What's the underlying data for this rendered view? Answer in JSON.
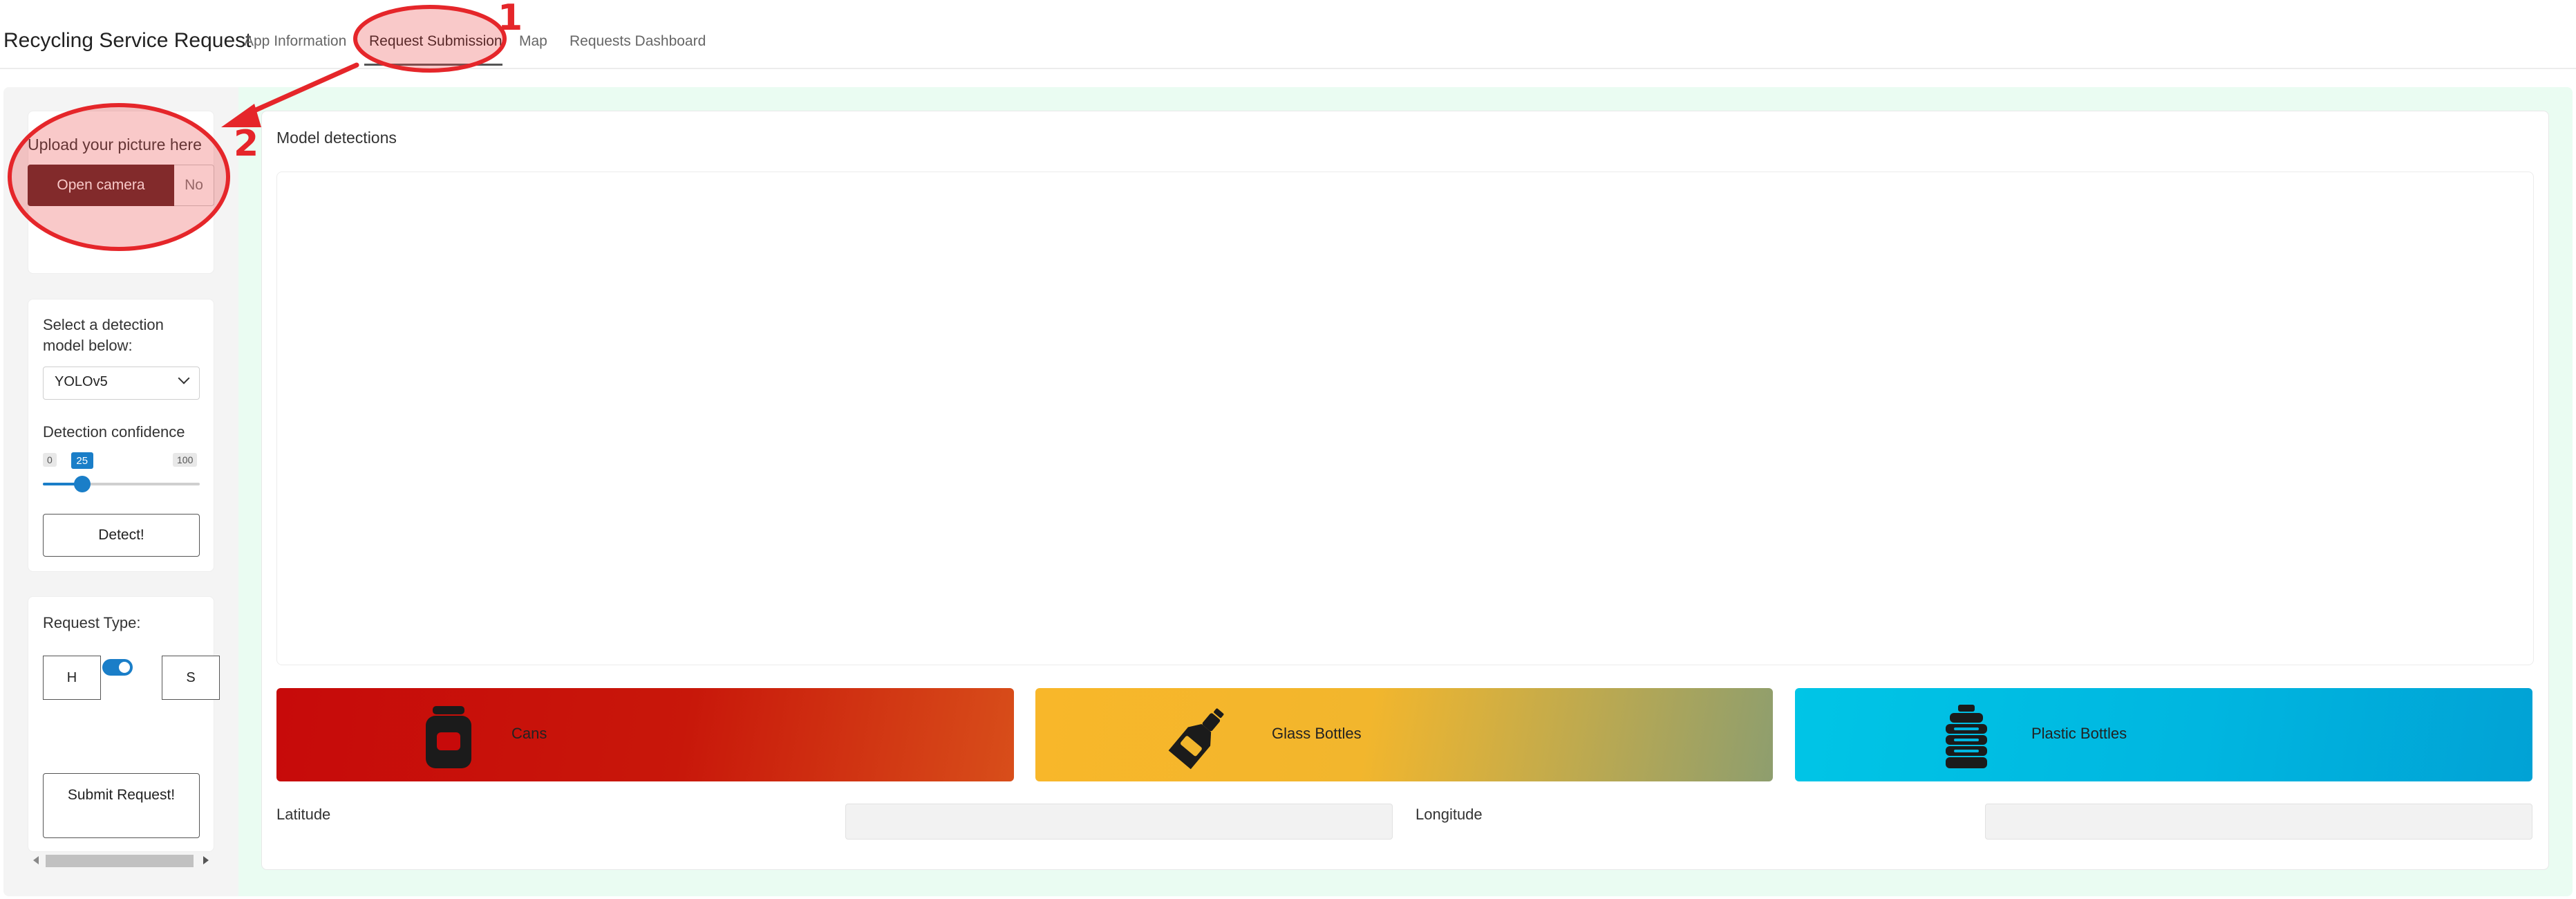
{
  "navbar": {
    "brand": "Recycling Service Request",
    "tabs": [
      {
        "label": "App Information"
      },
      {
        "label": "Request Submission"
      },
      {
        "label": "Map"
      },
      {
        "label": "Requests Dashboard"
      }
    ]
  },
  "sidebar": {
    "upload": {
      "label": "Upload your picture here",
      "camera_button": "Open camera",
      "file_status": "No"
    },
    "model": {
      "select_label": "Select a detection model below:",
      "selected_model": "YOLOv5",
      "confidence_label": "Detection confidence",
      "slider": {
        "min": "0",
        "max": "100",
        "value": "25",
        "fraction": 0.25
      },
      "detect_button": "Detect!"
    },
    "request": {
      "label": "Request Type:",
      "option_left": "H",
      "option_right": "S",
      "toggle_on": true,
      "submit_button": "Submit Request!"
    }
  },
  "main": {
    "detections_label": "Model detections",
    "categories": [
      {
        "label": "Cans",
        "icon": "can-icon"
      },
      {
        "label": "Glass Bottles",
        "icon": "glass-bottle-icon"
      },
      {
        "label": "Plastic Bottles",
        "icon": "plastic-bottle-icon"
      }
    ],
    "latitude_label": "Latitude",
    "longitude_label": "Longitude"
  },
  "annotations": {
    "marker_1": "1",
    "marker_2": "2",
    "color": "#e5262a"
  },
  "colors": {
    "accent": "#1a7ec8",
    "camera_button": "#5a2324",
    "cans": "#c70a0a",
    "glass": "#f8b72a",
    "plastic": "#00b6e0"
  }
}
